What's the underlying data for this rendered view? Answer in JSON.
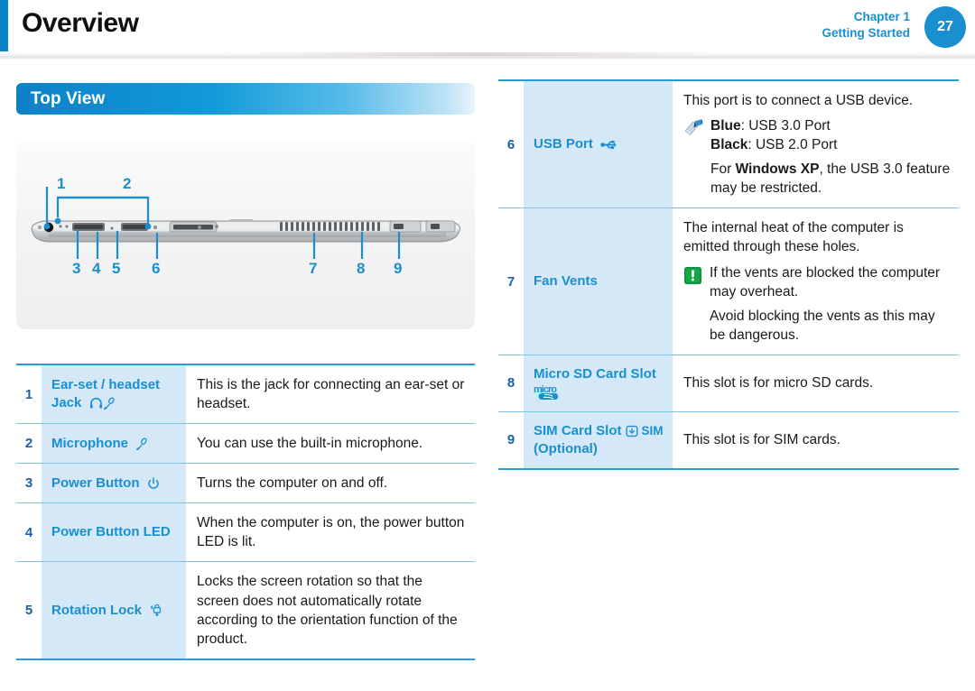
{
  "header": {
    "title": "Overview",
    "chapter_line1": "Chapter 1",
    "chapter_line2": "Getting Started",
    "page_number": "27",
    "accent_color": "#1a8fd0"
  },
  "section": {
    "title": "Top View"
  },
  "figure": {
    "name": "tablet-top-view-photo",
    "callouts": [
      "1",
      "2",
      "3",
      "4",
      "5",
      "6",
      "7",
      "8",
      "9"
    ]
  },
  "left_table": {
    "rows": [
      {
        "num": "1",
        "label": "Ear-set / headset Jack",
        "icons": [
          "headphone-icon",
          "microphone-icon"
        ],
        "desc": "This is the jack for connecting an ear-set or headset."
      },
      {
        "num": "2",
        "label": "Microphone",
        "icons": [
          "microphone-icon"
        ],
        "desc": "You can use the built-in microphone."
      },
      {
        "num": "3",
        "label": "Power Button",
        "icons": [
          "power-icon"
        ],
        "desc": "Turns the computer on and off."
      },
      {
        "num": "4",
        "label": "Power Button LED",
        "icons": [],
        "desc": "When the computer is on, the power button LED is lit."
      },
      {
        "num": "5",
        "label": "Rotation Lock",
        "icons": [
          "rotation-lock-icon"
        ],
        "desc": "Locks the screen rotation so that the screen does not automatically rotate according to the orientation function of the product."
      }
    ]
  },
  "right_table": {
    "rows": [
      {
        "num": "6",
        "label": "USB Port",
        "icons": [
          "usb-icon"
        ],
        "desc_intro": "This port is to connect a USB device.",
        "note_icon": "note-pencil-icon",
        "note_lines": [
          {
            "bold": "Blue",
            "rest": ": USB 3.0 Port"
          },
          {
            "bold": "Black",
            "rest": ": USB 2.0 Port"
          }
        ],
        "desc_outro_pre": "For ",
        "desc_outro_bold": "Windows XP",
        "desc_outro_post": ", the USB 3.0 feature may be restricted."
      },
      {
        "num": "7",
        "label": "Fan Vents",
        "icons": [],
        "desc_intro": "The internal heat of the computer is emitted through these holes.",
        "warn_icon": "warning-exclamation-icon",
        "warn_text": "If the vents are blocked the computer may overheat.",
        "warn_text2": "Avoid blocking the vents as this may be dangerous."
      },
      {
        "num": "8",
        "label": "Micro SD Card Slot",
        "icons": [
          "micro-sd-logo-icon"
        ],
        "desc": "This slot is for micro SD cards."
      },
      {
        "num": "9",
        "label": "SIM Card Slot",
        "label2": "(Optional)",
        "sim_badge": "SIM",
        "icons": [
          "sim-card-slot-icon"
        ],
        "desc": "This slot is for SIM cards."
      }
    ]
  },
  "colors": {
    "brand_blue": "#1a8fd0",
    "label_bg": "#d4e8f7",
    "row_border": "#7fc3e4",
    "warn_green": "#1a9b44"
  }
}
